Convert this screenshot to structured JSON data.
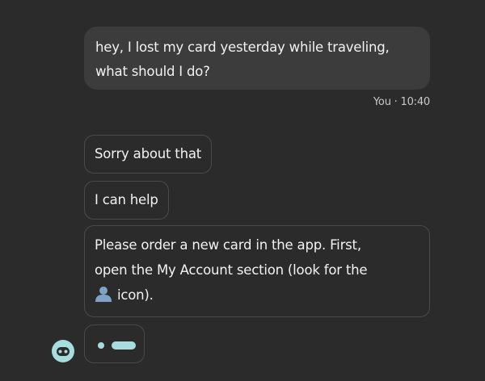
{
  "messages": {
    "user": {
      "line1": "hey, I lost my card yesterday while traveling,",
      "line2": "what should I do?",
      "meta": "You · 10:40"
    },
    "bot": [
      {
        "text": "Sorry about that"
      },
      {
        "text": "I can help"
      },
      {
        "line1": "Please order a new card in the app. First,",
        "line2": "open the My Account section (look for the",
        "line3": "icon).",
        "inline_icon": "user-account-icon"
      }
    ]
  },
  "typing_indicator": {
    "state": "typing"
  },
  "bot_avatar": {
    "icon": "bot-avatar-icon",
    "color": "#a8dde0"
  },
  "colors": {
    "background": "#2b2b2b",
    "user_bubble": "#3c3c3c",
    "bot_border": "#4a4a4a",
    "accent": "#a8dde0",
    "user_icon": "#7fa3c6"
  }
}
